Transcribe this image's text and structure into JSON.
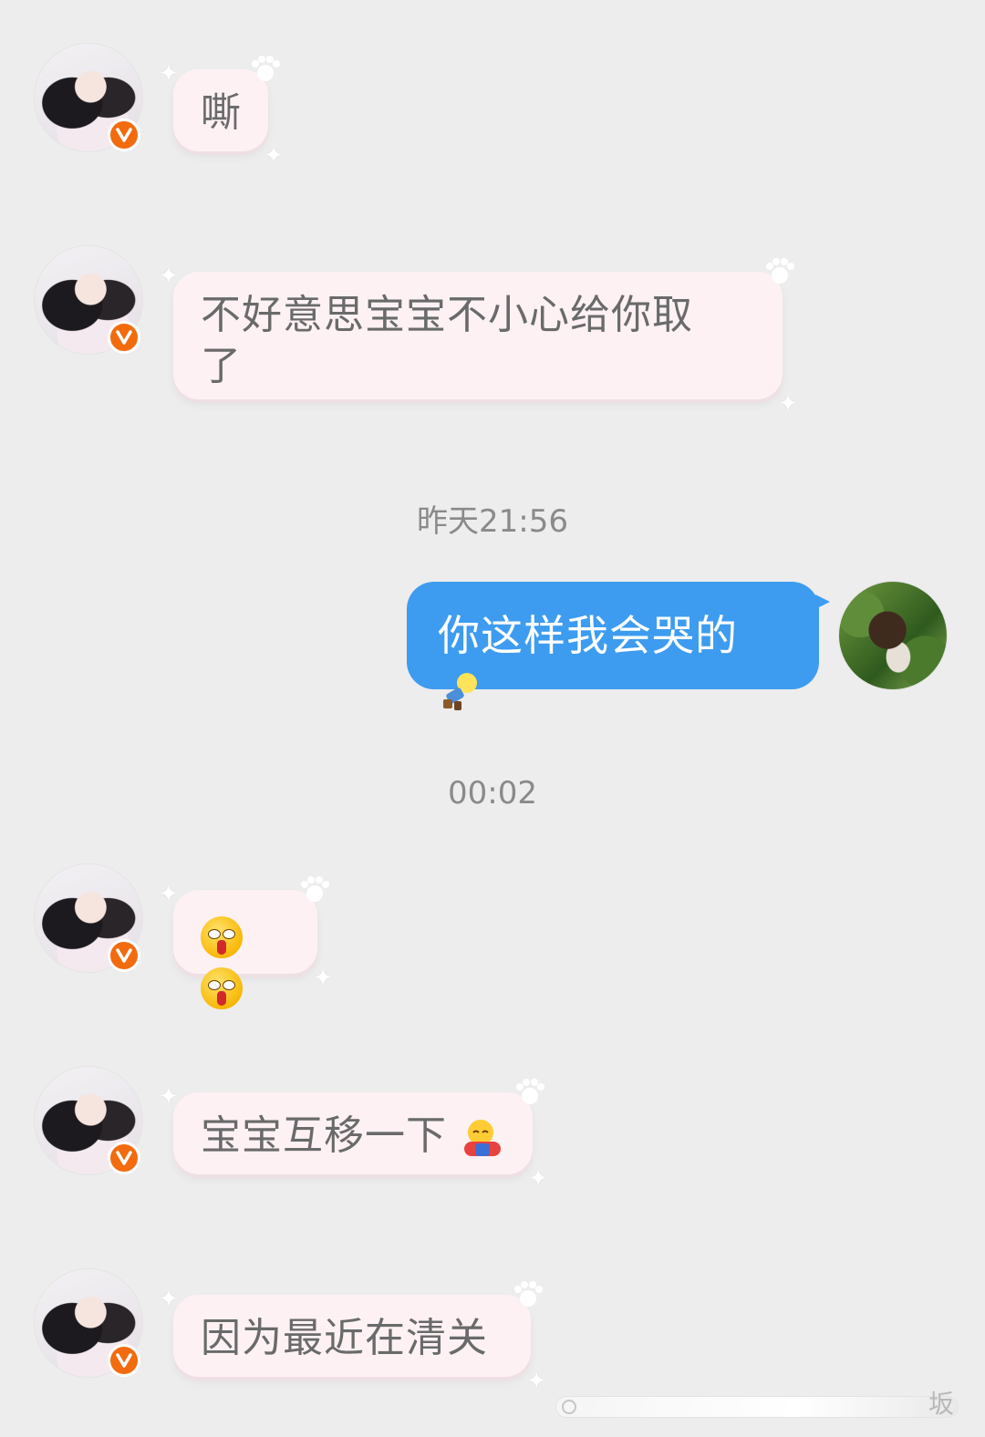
{
  "colors": {
    "background": "#ededed",
    "incoming_bubble": "#fdf1f4",
    "outgoing_bubble": "#3d9cf0",
    "verified_badge": "#f26b0f",
    "timestamp_text": "#8a8a8a"
  },
  "messages": [
    {
      "sender": "other",
      "text": "嘶",
      "verified": true
    },
    {
      "sender": "other",
      "text": "不好意思宝宝不小心给你取了",
      "verified": true
    },
    {
      "type": "timestamp",
      "text": "昨天21:56"
    },
    {
      "sender": "self",
      "text": "你这样我会哭的",
      "emoji": "lightbulb-person-emoji"
    },
    {
      "type": "timestamp",
      "text": "00:02"
    },
    {
      "sender": "other",
      "text": "",
      "emoji": "nosebleed-face-emoji x2",
      "verified": true
    },
    {
      "sender": "other",
      "text": "宝宝互移一下",
      "emoji": "hug-face-emoji",
      "verified": true
    },
    {
      "sender": "other",
      "text": "因为最近在清关",
      "verified": true
    }
  ],
  "badge": {
    "label": "V"
  },
  "bottom_bar": {
    "partial_text": "坂"
  }
}
